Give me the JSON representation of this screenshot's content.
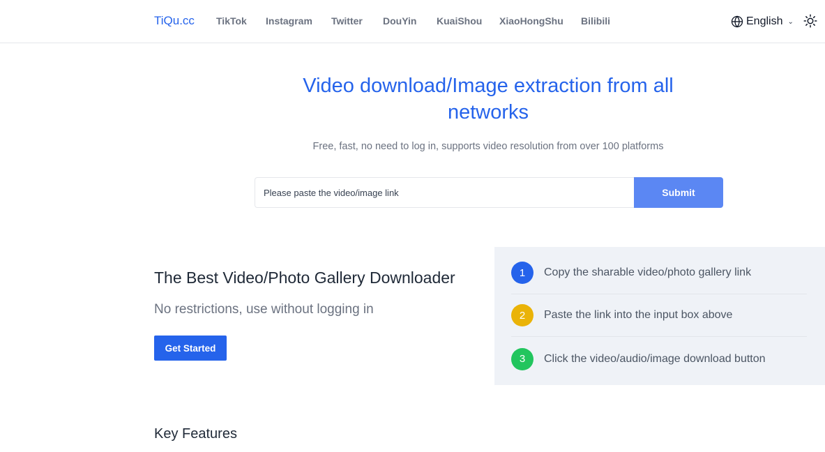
{
  "header": {
    "brand": "TiQu.cc",
    "nav": [
      "TikTok",
      "Instagram",
      "Twitter",
      "DouYin",
      "KuaiShou",
      "XiaoHongShu",
      "Bilibili"
    ],
    "language": "English",
    "icons": {
      "language": "globe-icon",
      "dropdown": "chevron-down-icon",
      "theme": "sun-icon"
    }
  },
  "hero": {
    "title": "Video download/Image extraction from all networks",
    "subtitle": "Free, fast, no need to log in, supports video resolution from over 100 platforms"
  },
  "search": {
    "placeholder": "Please paste the video/image link",
    "value": "",
    "submit_label": "Submit"
  },
  "feature": {
    "heading": "The Best Video/Photo Gallery Downloader",
    "subheading": "No restrictions, use without logging in",
    "cta_label": "Get Started"
  },
  "steps": [
    {
      "number": "1",
      "text": "Copy the sharable video/photo gallery link",
      "color": "#2563eb"
    },
    {
      "number": "2",
      "text": "Paste the link into the input box above",
      "color": "#eab308"
    },
    {
      "number": "3",
      "text": "Click the video/audio/image download button",
      "color": "#22c55e"
    }
  ],
  "key_features": {
    "heading": "Key Features"
  },
  "colors": {
    "accent": "#2563eb",
    "submit": "#5b87f3",
    "steps_bg": "#eff2f7"
  }
}
